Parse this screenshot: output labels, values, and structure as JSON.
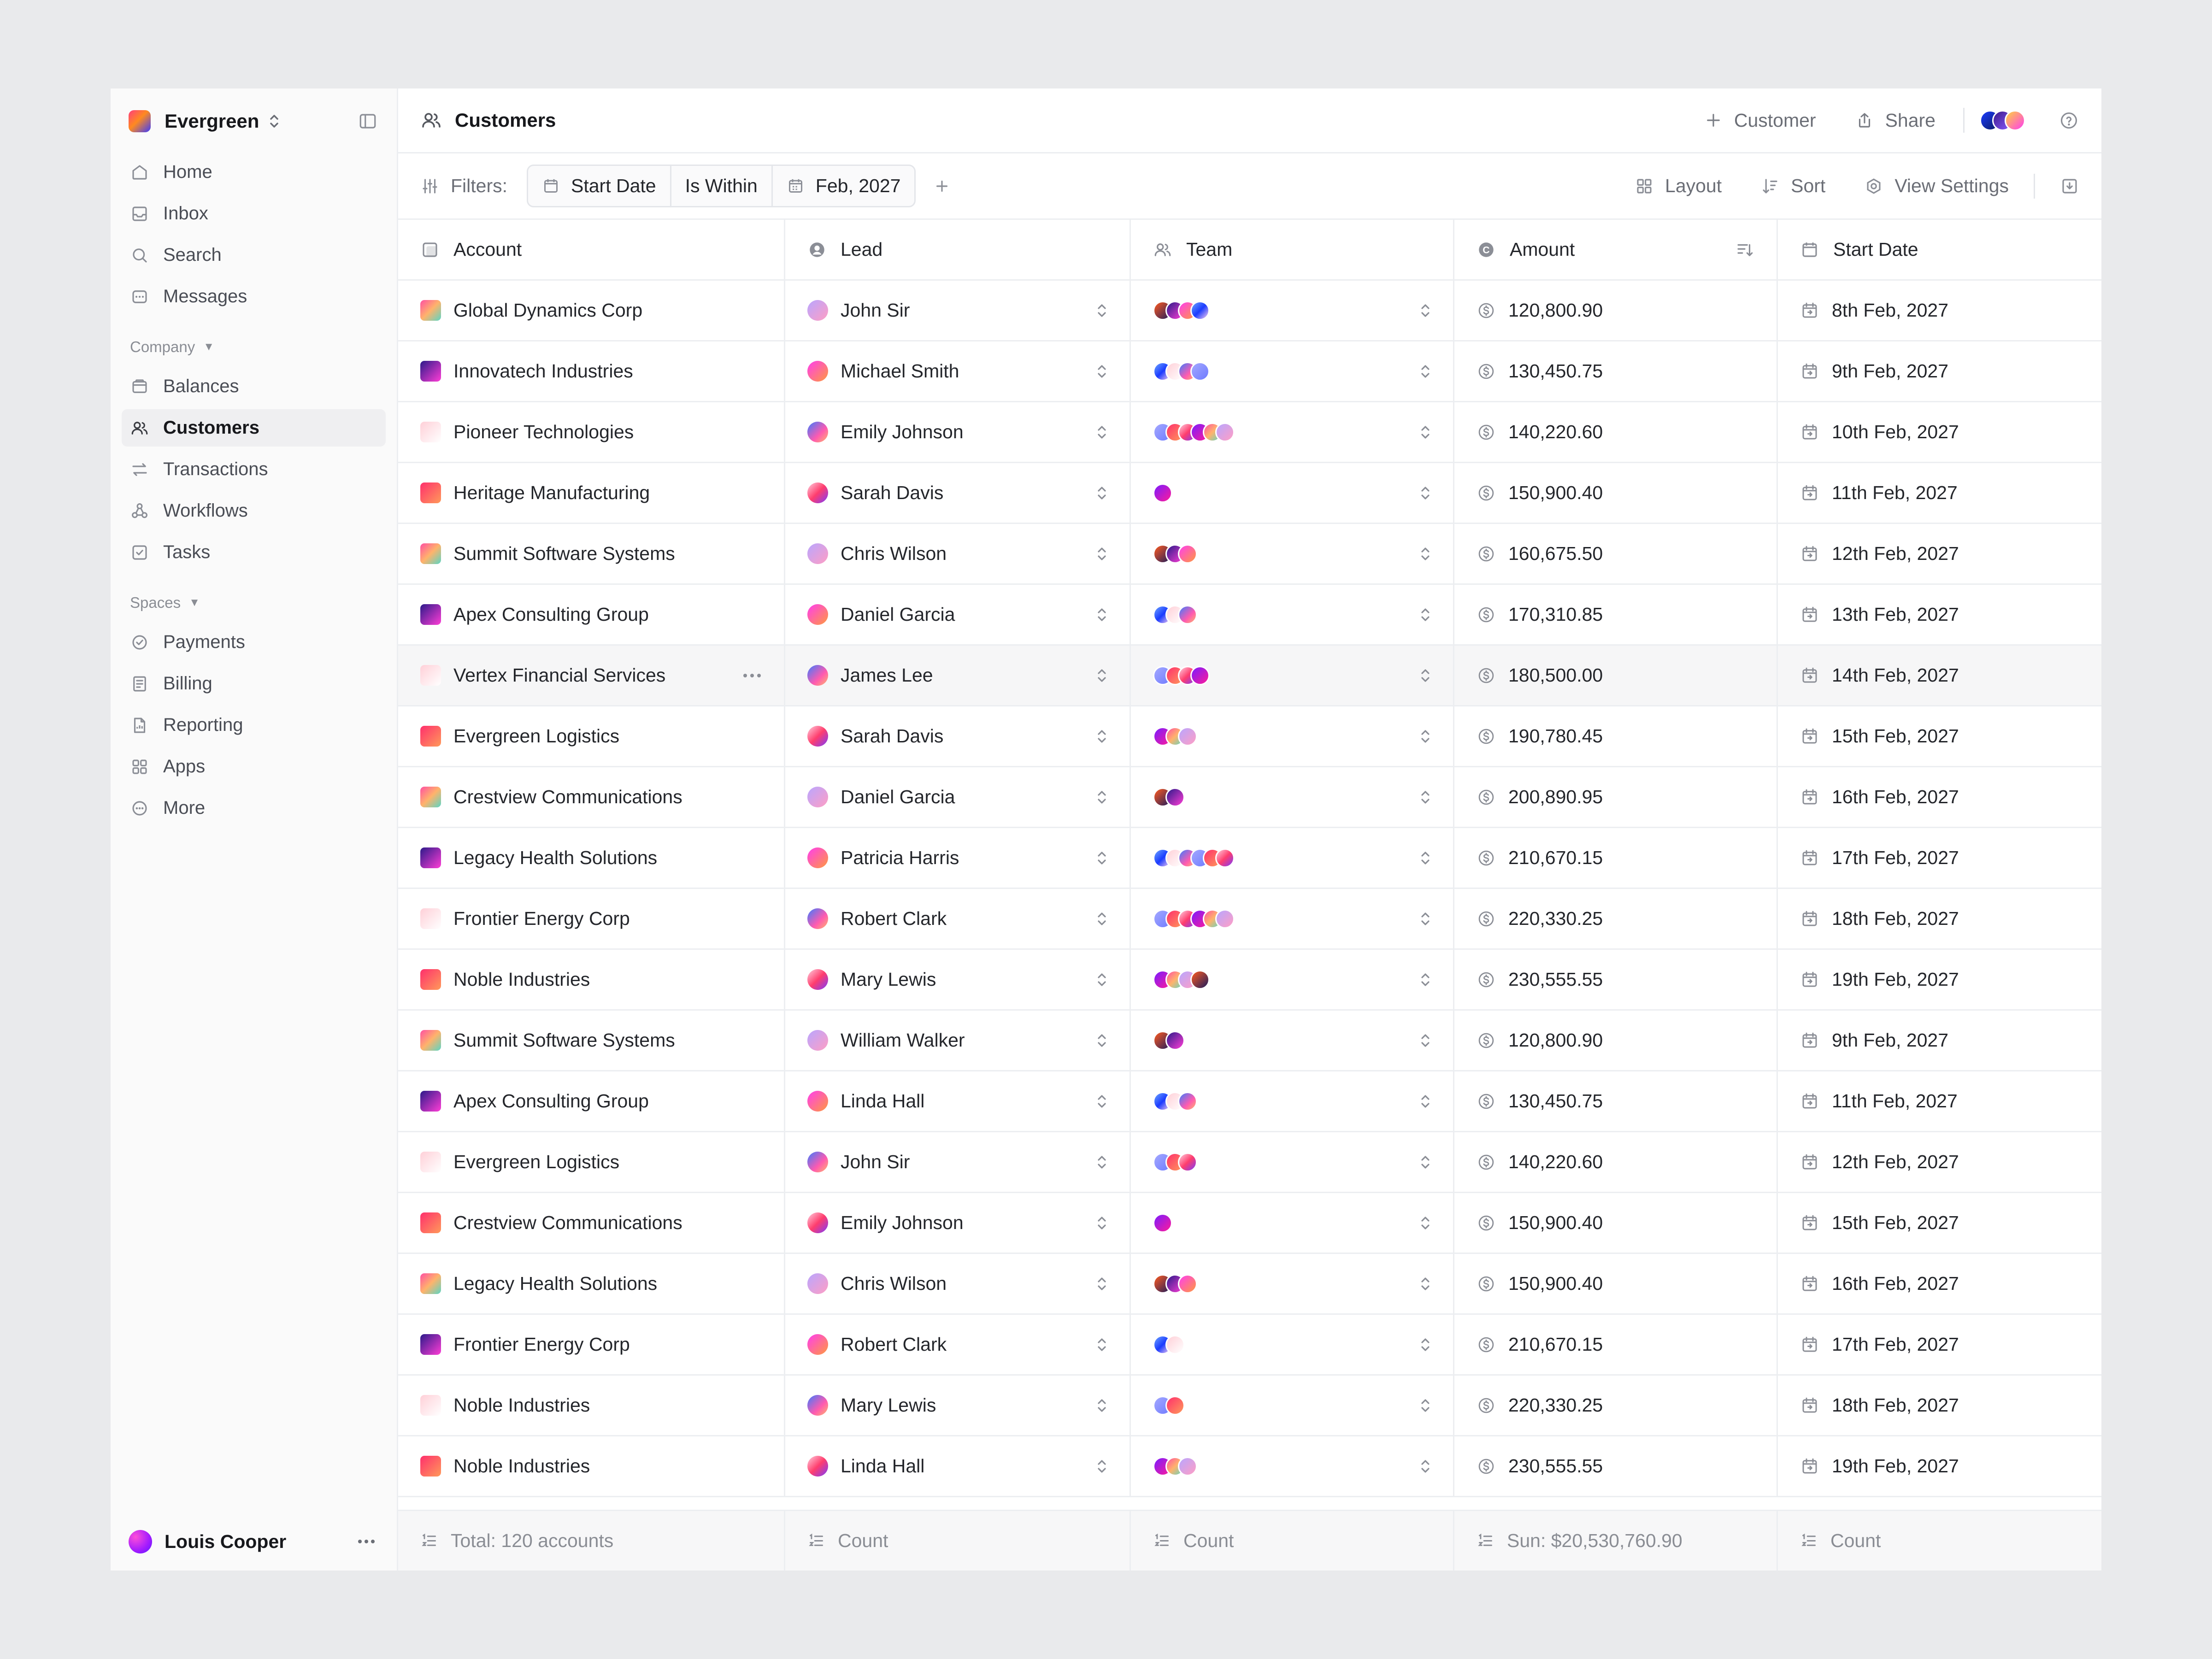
{
  "workspace": {
    "name": "Evergreen"
  },
  "nav": {
    "main": [
      {
        "label": "Home",
        "icon": "home-icon"
      },
      {
        "label": "Inbox",
        "icon": "inbox-icon"
      },
      {
        "label": "Search",
        "icon": "search-icon"
      },
      {
        "label": "Messages",
        "icon": "messages-icon"
      }
    ],
    "company_label": "Company",
    "company": [
      {
        "label": "Balances",
        "icon": "wallet-icon"
      },
      {
        "label": "Customers",
        "icon": "users-icon",
        "active": true
      },
      {
        "label": "Transactions",
        "icon": "transfer-icon"
      },
      {
        "label": "Workflows",
        "icon": "workflow-icon"
      },
      {
        "label": "Tasks",
        "icon": "task-check-icon"
      }
    ],
    "spaces_label": "Spaces",
    "spaces": [
      {
        "label": "Payments",
        "icon": "check-circle-icon"
      },
      {
        "label": "Billing",
        "icon": "receipt-icon"
      },
      {
        "label": "Reporting",
        "icon": "report-file-icon"
      },
      {
        "label": "Apps",
        "icon": "apps-grid-icon"
      },
      {
        "label": "More",
        "icon": "more-circle-icon"
      }
    ]
  },
  "user": {
    "name": "Louis Cooper"
  },
  "topbar": {
    "title": "Customers",
    "add_customer": "Customer",
    "share": "Share"
  },
  "filters": {
    "label": "Filters:",
    "field": "Start Date",
    "operator": "Is Within",
    "value": "Feb, 2027"
  },
  "view_actions": {
    "layout": "Layout",
    "sort": "Sort",
    "view_settings": "View Settings"
  },
  "table": {
    "columns": {
      "account": "Account",
      "lead": "Lead",
      "team": "Team",
      "amount": "Amount",
      "start_date": "Start Date"
    },
    "rows": [
      {
        "account": "Global Dynamics Corp",
        "lead": "John Sir",
        "team_size": 4,
        "amount": "120,800.90",
        "start_date": "8th Feb, 2027"
      },
      {
        "account": "Innovatech Industries",
        "lead": "Michael Smith",
        "team_size": 4,
        "amount": "130,450.75",
        "start_date": "9th Feb, 2027"
      },
      {
        "account": "Pioneer Technologies",
        "lead": "Emily Johnson",
        "team_size": 6,
        "amount": "140,220.60",
        "start_date": "10th Feb, 2027"
      },
      {
        "account": "Heritage Manufacturing",
        "lead": "Sarah Davis",
        "team_size": 1,
        "amount": "150,900.40",
        "start_date": "11th Feb, 2027"
      },
      {
        "account": "Summit Software Systems",
        "lead": "Chris Wilson",
        "team_size": 3,
        "amount": "160,675.50",
        "start_date": "12th Feb, 2027"
      },
      {
        "account": "Apex Consulting Group",
        "lead": "Daniel Garcia",
        "team_size": 3,
        "amount": "170,310.85",
        "start_date": "13th Feb, 2027"
      },
      {
        "account": "Vertex Financial Services",
        "lead": "James Lee",
        "team_size": 4,
        "amount": "180,500.00",
        "start_date": "14th Feb, 2027"
      },
      {
        "account": "Evergreen Logistics",
        "lead": "Sarah Davis",
        "team_size": 3,
        "amount": "190,780.45",
        "start_date": "15th Feb, 2027"
      },
      {
        "account": "Crestview Communications",
        "lead": "Daniel Garcia",
        "team_size": 2,
        "amount": "200,890.95",
        "start_date": "16th Feb, 2027"
      },
      {
        "account": "Legacy Health Solutions",
        "lead": "Patricia Harris",
        "team_size": 6,
        "amount": "210,670.15",
        "start_date": "17th Feb, 2027"
      },
      {
        "account": "Frontier Energy Corp",
        "lead": "Robert Clark",
        "team_size": 6,
        "amount": "220,330.25",
        "start_date": "18th Feb, 2027"
      },
      {
        "account": "Noble Industries",
        "lead": "Mary Lewis",
        "team_size": 4,
        "amount": "230,555.55",
        "start_date": "19th Feb, 2027"
      },
      {
        "account": "Summit Software Systems",
        "lead": "William Walker",
        "team_size": 2,
        "amount": "120,800.90",
        "start_date": "9th Feb, 2027"
      },
      {
        "account": "Apex Consulting Group",
        "lead": "Linda Hall",
        "team_size": 3,
        "amount": "130,450.75",
        "start_date": "11th Feb, 2027"
      },
      {
        "account": "Evergreen Logistics",
        "lead": "John Sir",
        "team_size": 3,
        "amount": "140,220.60",
        "start_date": "12th Feb, 2027"
      },
      {
        "account": "Crestview Communications",
        "lead": "Emily Johnson",
        "team_size": 1,
        "amount": "150,900.40",
        "start_date": "15th Feb, 2027"
      },
      {
        "account": "Legacy Health Solutions",
        "lead": "Chris Wilson",
        "team_size": 3,
        "amount": "150,900.40",
        "start_date": "16th Feb, 2027"
      },
      {
        "account": "Frontier Energy Corp",
        "lead": "Robert Clark",
        "team_size": 2,
        "amount": "210,670.15",
        "start_date": "17th Feb, 2027"
      },
      {
        "account": "Noble Industries",
        "lead": "Mary Lewis",
        "team_size": 2,
        "amount": "220,330.25",
        "start_date": "18th Feb, 2027"
      },
      {
        "account": "Noble Industries",
        "lead": "Linda Hall",
        "team_size": 3,
        "amount": "230,555.55",
        "start_date": "19th Feb, 2027"
      }
    ],
    "footer": {
      "account": "Total: 120 accounts",
      "lead": "Count",
      "team": "Count",
      "amount": "Sun: $20,530,760.90",
      "start_date": "Count"
    }
  },
  "colors": {
    "accent_gradients": [
      "linear-gradient(135deg,#ff4fa3,#ffb36b 50%,#5ad6c5)",
      "linear-gradient(135deg,#b9a6ff,#ff9ec4)",
      "linear-gradient(135deg,#ff5a1f,#1b1b5e)",
      "linear-gradient(135deg,#2c1a8a,#ff3dd6)",
      "linear-gradient(135deg,#ff3df0,#ff9a3d)",
      "linear-gradient(135deg,#6fa6ff,#1b3bff 50%,#ffd0f0)",
      "linear-gradient(135deg,#ffd0d8,#ffffff)",
      "linear-gradient(135deg,#3b7bff,#ff5ab0 60%,#ffb86b)",
      "linear-gradient(135deg,#a3a8ff,#6f7bff)",
      "linear-gradient(135deg,#ff2f6d,#ff9a5a)",
      "linear-gradient(135deg,#ffd0e0,#ff3d6d 50%,#7b3bff)",
      "linear-gradient(135deg,#7b1bff,#ff1b9a)"
    ]
  }
}
